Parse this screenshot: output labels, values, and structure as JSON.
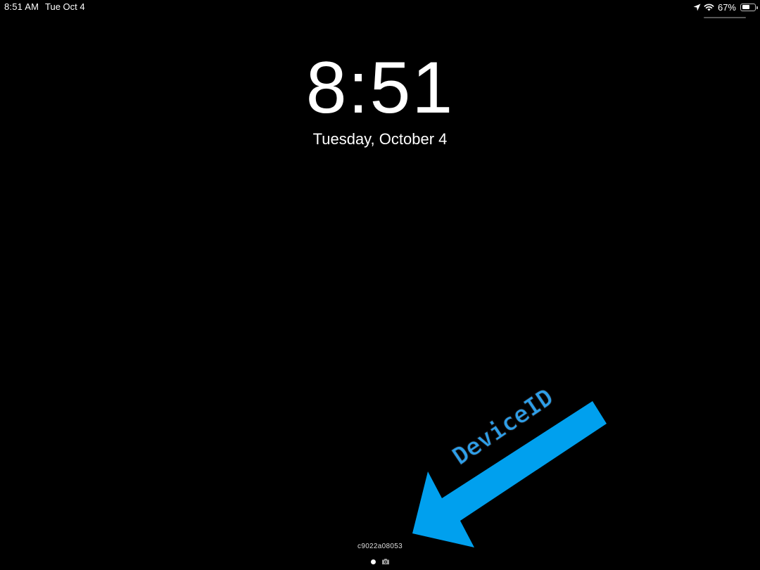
{
  "status_bar": {
    "time": "8:51 AM",
    "date": "Tue Oct 4",
    "battery_percent": "67%",
    "battery_level": 0.67,
    "icons": [
      "location-icon",
      "wifi-icon",
      "battery-icon"
    ]
  },
  "lock_screen": {
    "time": "8:51",
    "date": "Tuesday, October 4",
    "device_id": "c9022a08053",
    "pages": [
      "home-page",
      "camera-page"
    ],
    "current_page": 0
  },
  "annotation": {
    "label": "DeviceID",
    "color": "#00a0ee"
  }
}
